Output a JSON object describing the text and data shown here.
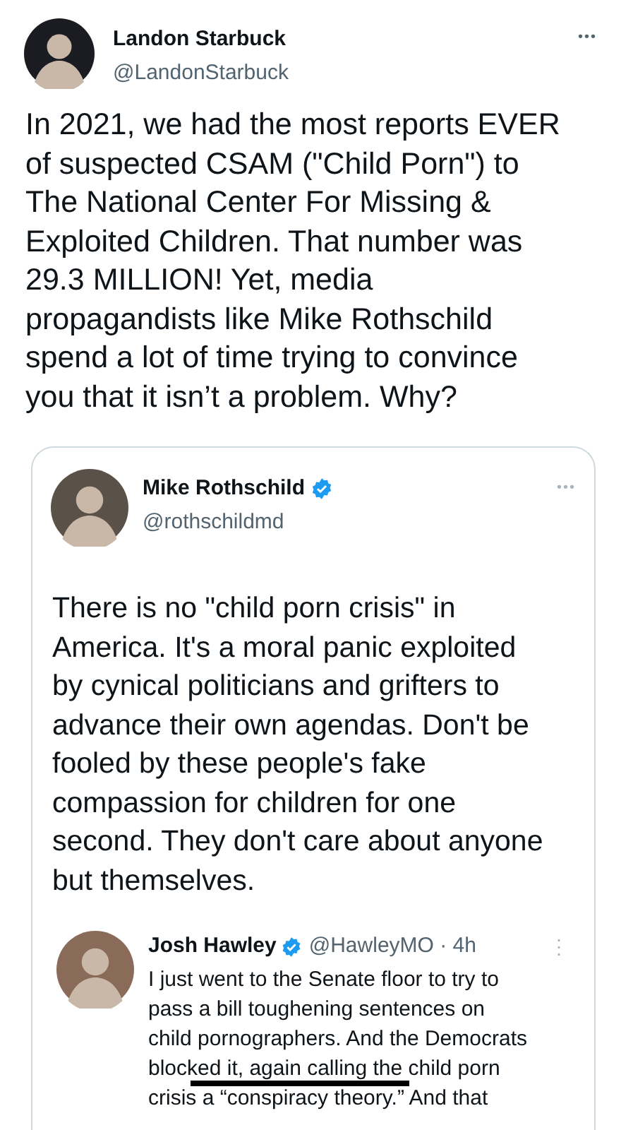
{
  "tweet": {
    "name": "Landon Starbuck",
    "handle": "@LandonStarbuck",
    "more": "•••",
    "text": "In 2021, we had the most reports EVER of suspected CSAM (\"Child Porn\") to The National Center For Missing & Exploited Children. That number was 29.3 MILLION! Yet, media propagandists like Mike Rothschild spend a lot of time trying to convince you that it isn’t a problem. Why?"
  },
  "quoted_tweet": {
    "name": "Mike Rothschild",
    "handle": "@rothschildmd",
    "verified": true,
    "more": "•••",
    "text": "There is no \"child porn crisis\" in America. It's a moral panic exploited by cynical politicians and grifters to advance their own agendas. Don't be fooled by these people's fake compassion for children for one second. They don't care about anyone but themselves."
  },
  "nested_tweet": {
    "name": "Josh Hawley",
    "handle": "@HawleyMO · 4h",
    "verified": true,
    "more": "⋮",
    "text": "I just went to the Senate floor to try to pass a bill toughening sentences on child pornographers. And the Democrats blocked it, again calling the child porn crisis a “conspiracy theory.” And that"
  }
}
